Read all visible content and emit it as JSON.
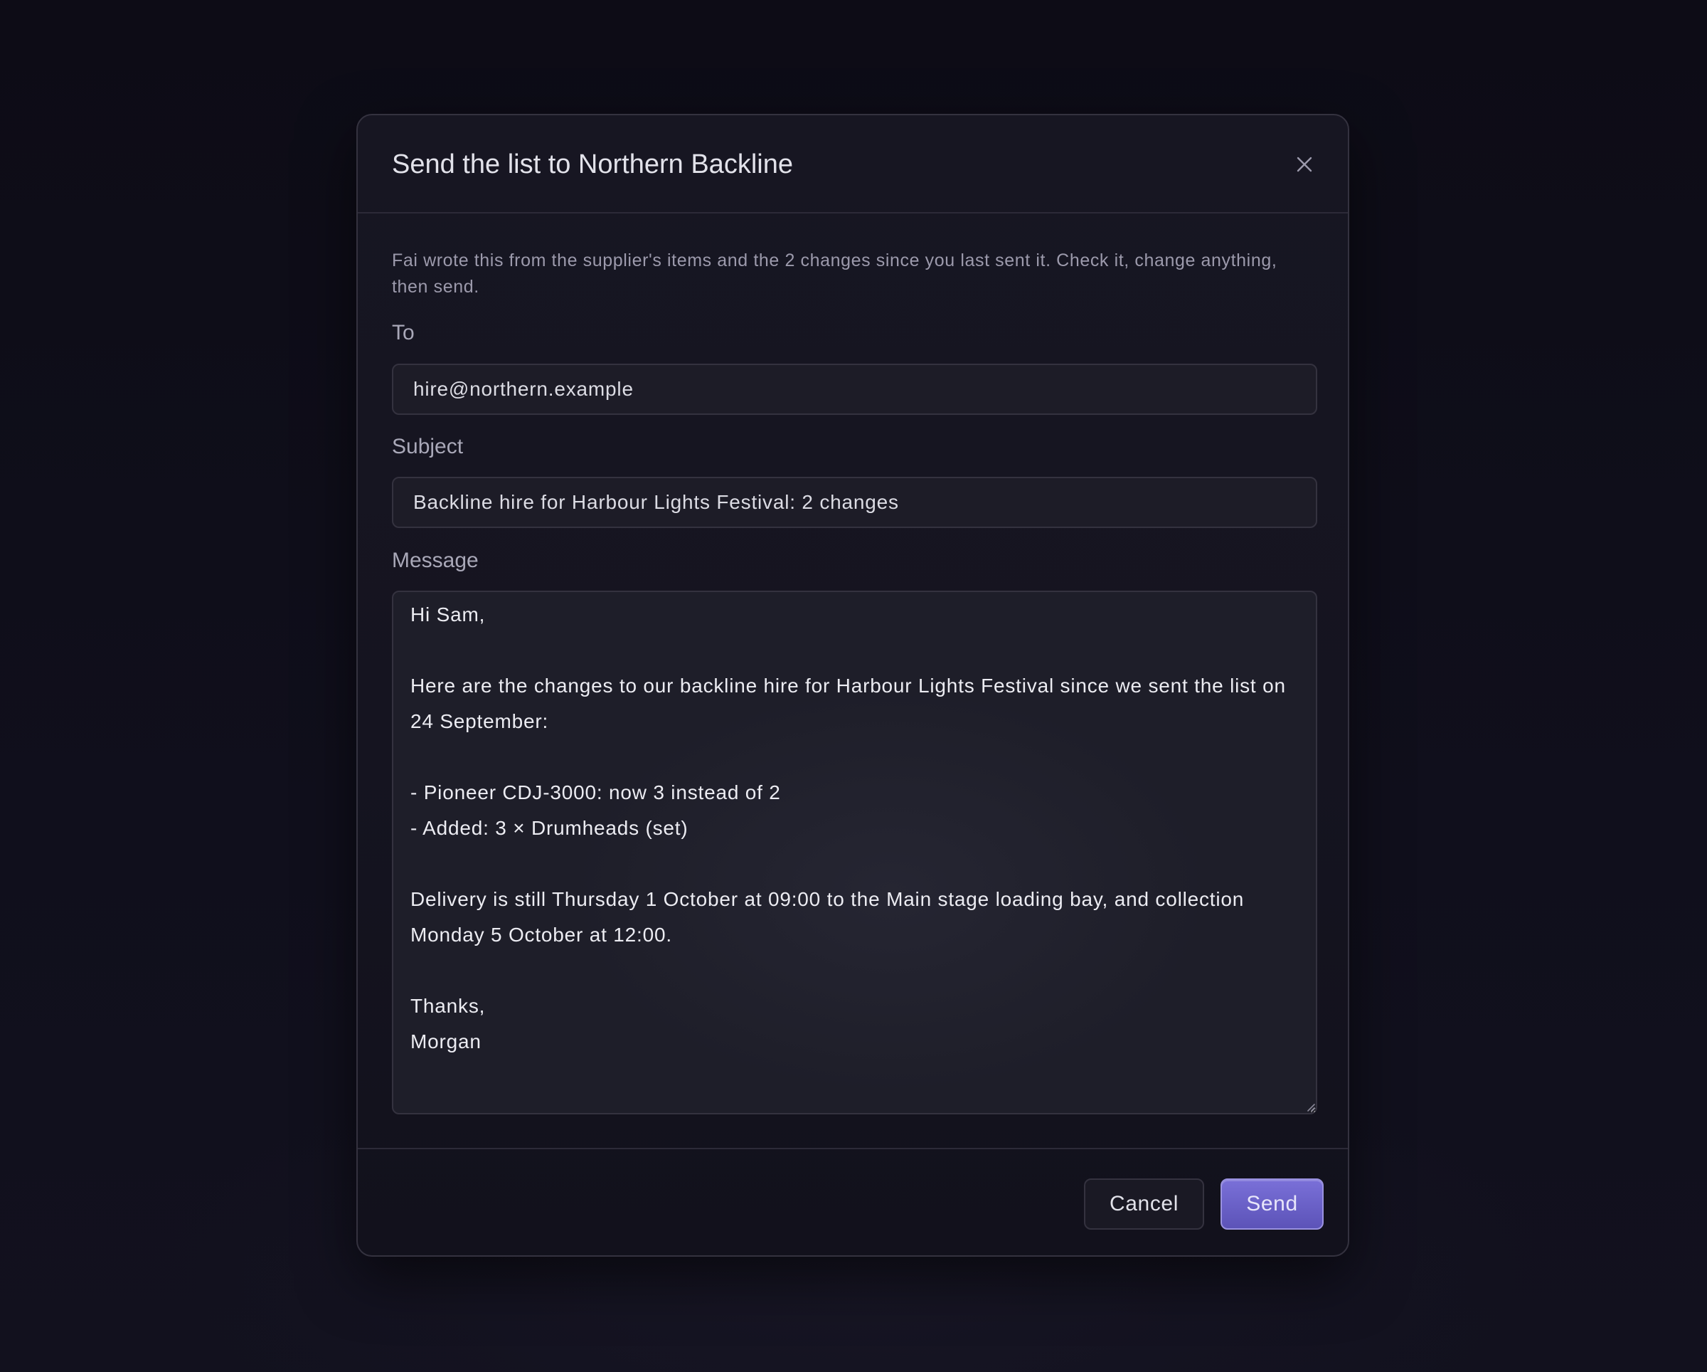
{
  "dialog": {
    "title": "Send the list to Northern Backline",
    "close_label": "×",
    "intro": "Fai wrote this from the supplier's items and the 2 changes since you last sent it. Check it, change anything, then send."
  },
  "form": {
    "to": {
      "label": "To",
      "value": "hire@northern.example"
    },
    "subject": {
      "label": "Subject",
      "value": "Backline hire for Harbour Lights Festival: 2 changes"
    },
    "message": {
      "label": "Message",
      "value": "Hi Sam,\n\nHere are the changes to our backline hire for Harbour Lights Festival since we sent the list on 24 September:\n\n- Pioneer CDJ-3000: now 3 instead of 2\n- Added: 3 × Drumheads (set)\n\nDelivery is still Thursday 1 October at 09:00 to the Main stage loading bay, and collection Monday 5 October at 12:00.\n\nThanks,\nMorgan"
    }
  },
  "actions": {
    "cancel_label": "Cancel",
    "send_label": "Send"
  },
  "icons": {
    "close": "close-icon",
    "resize": "resize-grip-icon"
  },
  "colors": {
    "accent": "#6b61c8",
    "background": "#0d0c16",
    "surface": "#161521"
  }
}
